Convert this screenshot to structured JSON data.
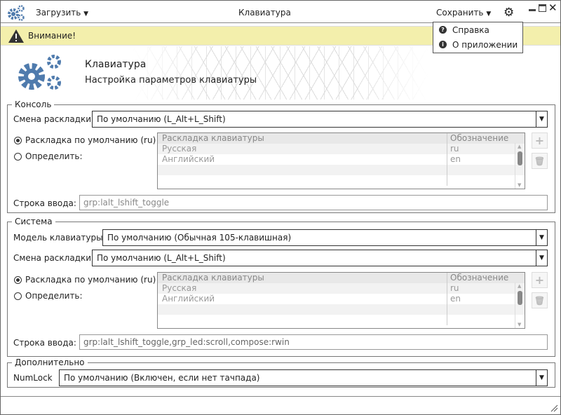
{
  "titlebar": {
    "load_label": "Загрузить",
    "title": "Клавиатура",
    "save_label": "Сохранить"
  },
  "menu": {
    "items": [
      {
        "label": "Справка",
        "icon": "question-icon"
      },
      {
        "label": "О приложении",
        "icon": "info-icon"
      }
    ]
  },
  "warning": {
    "text": "Внимание!"
  },
  "header": {
    "title": "Клавиатура",
    "subtitle": "Настройка параметров клавиатуры"
  },
  "console": {
    "legend": "Консоль",
    "switch_label": "Смена раскладки:",
    "switch_value": "По умолчанию (L_Alt+L_Shift)",
    "radio_default": "Раскладка по умолчанию (ru)",
    "radio_define": "Определить:",
    "table": {
      "headers": [
        "Раскладка клавиатуры",
        "Обозначение"
      ],
      "rows": [
        [
          "Русская",
          "ru"
        ],
        [
          "Английский",
          "en"
        ]
      ]
    },
    "input_label": "Строка ввода:",
    "input_value": "grp:lalt_lshift_toggle"
  },
  "system": {
    "legend": "Система",
    "model_label": "Модель клавиатуры:",
    "model_value": "По умолчанию (Обычная 105-клавишная)",
    "switch_label": "Смена раскладки:",
    "switch_value": "По умолчанию (L_Alt+L_Shift)",
    "radio_default": "Раскладка по умолчанию (ru)",
    "radio_define": "Определить:",
    "table": {
      "headers": [
        "Раскладка клавиатуры",
        "Обозначение"
      ],
      "rows": [
        [
          "Русская",
          "ru"
        ],
        [
          "Английский",
          "en"
        ]
      ]
    },
    "input_label": "Строка ввода:",
    "input_value": "grp:lalt_lshift_toggle,grp_led:scroll,compose:rwin"
  },
  "extra": {
    "legend": "Дополнительно",
    "numlock_label": "NumLock",
    "numlock_value": "По умолчанию (Включен, если нет тачпада)"
  },
  "colors": {
    "accent": "#4f7bad",
    "warning_bg": "#f3efac"
  }
}
